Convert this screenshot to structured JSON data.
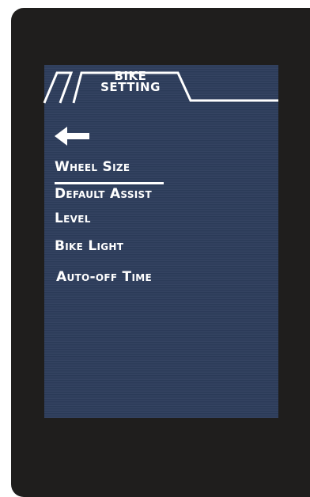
{
  "header": {
    "title_line1": "BIKE",
    "title_line2": "SETTING"
  },
  "menu": {
    "back_icon": "arrow-left-icon",
    "items": [
      {
        "label": "Wheel Size",
        "selected": true
      },
      {
        "label": "Default Assist"
      },
      {
        "label": "Level"
      },
      {
        "label": "Bike Light"
      },
      {
        "label": "Auto-off Time"
      }
    ]
  },
  "colors": {
    "bezel": "#1f1e1d",
    "screen": "#2d3d5c",
    "text": "#ffffff"
  }
}
